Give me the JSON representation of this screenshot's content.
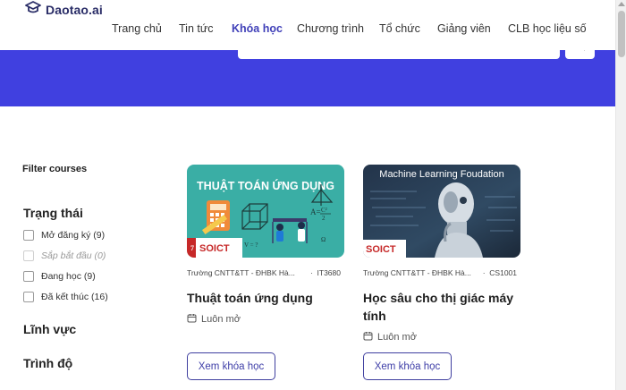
{
  "brand": {
    "name": "Daotao.ai",
    "accent": "#4040e0"
  },
  "nav": {
    "items": [
      {
        "label": "Trang chủ",
        "active": false
      },
      {
        "label": "Tin tức",
        "active": false
      },
      {
        "label": "Khóa học",
        "active": true
      },
      {
        "label": "Chương trình",
        "active": false
      },
      {
        "label": "Tổ chức",
        "active": false
      },
      {
        "label": "Giảng viên",
        "active": false
      },
      {
        "label": "CLB học liệu số",
        "active": false
      }
    ]
  },
  "search": {
    "placeholder": "",
    "button_icon": "search-icon"
  },
  "filter": {
    "title": "Filter courses",
    "status": {
      "title": "Trạng thái",
      "options": [
        {
          "label": "Mở đăng ký (9)",
          "disabled": false
        },
        {
          "label": "Sắp bắt đầu (0)",
          "disabled": true
        },
        {
          "label": "Đang học (9)",
          "disabled": false
        },
        {
          "label": "Đã kết thúc (16)",
          "disabled": false
        }
      ]
    },
    "field_title": "Lĩnh vực",
    "level_title": "Trình độ"
  },
  "courses": [
    {
      "thumb_title": "THUẬT TOÁN ỨNG DỤNG",
      "thumb_logo": "SOICT",
      "school": "Trường CNTT&TT - ĐHBK Hà...",
      "code": "IT3680",
      "title": "Thuật toán ứng dụng",
      "status": "Luôn mở",
      "button": "Xem khóa học"
    },
    {
      "thumb_title": "Machine Learning Foudation",
      "thumb_logo": "SOICT",
      "school": "Trường CNTT&TT - ĐHBK Hà...",
      "code": "CS1001",
      "title": "Học sâu cho thị giác máy tính",
      "status": "Luôn mở",
      "button": "Xem khóa học"
    }
  ]
}
